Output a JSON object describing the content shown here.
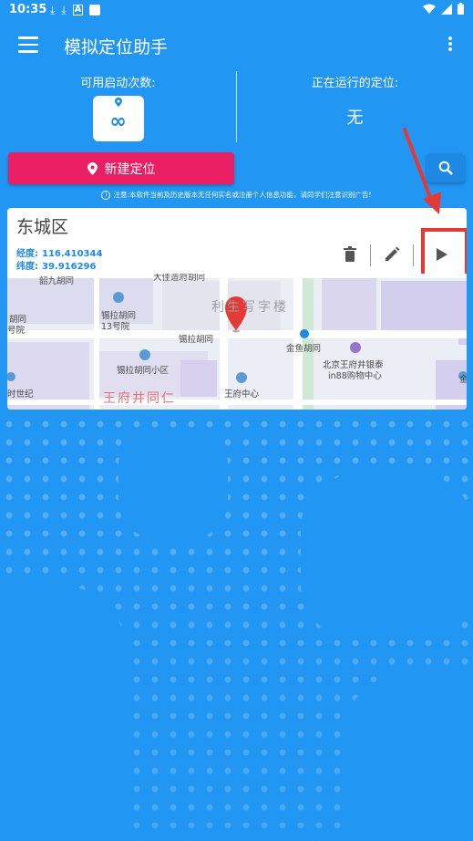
{
  "status_bar": {
    "time": "10:35"
  },
  "app_bar": {
    "title": "模拟定位助手"
  },
  "counter": {
    "label": "可用启动次数:",
    "value": "∞"
  },
  "running": {
    "label": "正在运行的定位:",
    "value": "无"
  },
  "new_location_button": "新建定位",
  "notice": "注意:本软件当前及历史版本无任何实名或注册个人信息功能，请同学们注意识别广告!",
  "location_card": {
    "title": "东城区",
    "longitude_label": "经度:",
    "longitude": "116.410344",
    "latitude_label": "纬度:",
    "latitude": "39.916296"
  },
  "map_labels": {
    "top_road": "大佳造府胡同",
    "alley1": "韶九胡同",
    "hutong_left": "胡同",
    "courtyard_left": "号院",
    "xila13": "锡拉胡同",
    "xila13_b": "13号院",
    "xila": "锡拉胡同",
    "xila_small": "锡拉胡同小区",
    "century": "时世纪",
    "wangfujing_ren": "王府井同仁",
    "wangfu_center": "王府中心",
    "lisheng": "利生写字楼",
    "jinyu": "金鱼胡同",
    "beijing_wangfujing": "北京王府井银泰",
    "in88": "in88购物中心",
    "jin": "金"
  },
  "colors": {
    "background": "#2196f3",
    "new_button": "#e91e63",
    "coordinate_text": "#1e88e5",
    "highlight": "#e53935"
  }
}
